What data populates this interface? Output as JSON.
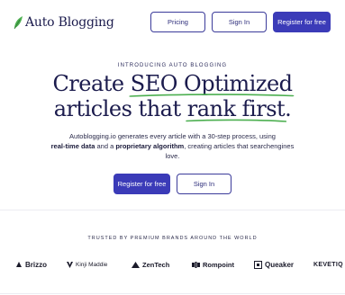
{
  "brand": {
    "name": "Auto Blogging",
    "icon": "leaf-icon",
    "accent": "#3b3bb8",
    "underline": "#4caf50"
  },
  "nav": {
    "pricing": "Pricing",
    "signin": "Sign In",
    "register": "Register for free"
  },
  "hero": {
    "eyebrow": "INTRODUCING AUTO BLOGGING",
    "headline_l1_pre": "Create ",
    "headline_l1_hl": "SEO Optimized",
    "headline_l2_pre": "articles that ",
    "headline_l2_hl": "rank first",
    "headline_l2_post": ".",
    "sub_part1": "Autoblogging.io generates every article with a 30-step process, using",
    "sub_bold1": "real-time data",
    "sub_part2": " and a ",
    "sub_bold2": "proprietary algorithm",
    "sub_part3": ", creating articles that searchengines love.",
    "cta_register": "Register for free",
    "cta_signin": "Sign In"
  },
  "trusted": {
    "label": "TRUSTED BY PREMIUM BRANDS AROUND THE WORLD",
    "brands": [
      {
        "name": "Brizzo",
        "icon": "brizzo-logo-icon"
      },
      {
        "name": "Kinji Maddie",
        "icon": "kinji-logo-icon"
      },
      {
        "name": "ZenTech",
        "icon": "zentech-logo-icon"
      },
      {
        "name": "Rompoint",
        "icon": "rompoint-logo-icon"
      },
      {
        "name": "Queaker",
        "icon": "queaker-logo-icon"
      },
      {
        "name": "KEVETIQ",
        "icon": ""
      }
    ]
  }
}
